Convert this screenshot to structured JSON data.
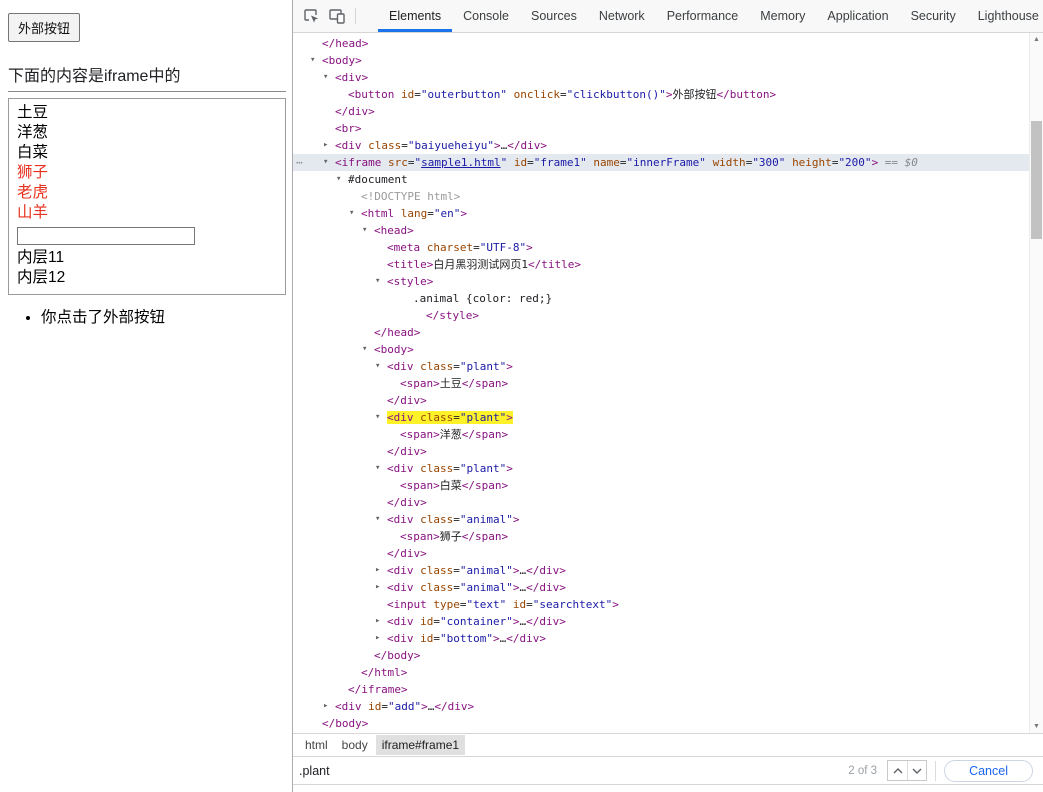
{
  "page": {
    "outer_button": "外部按钮",
    "heading": "下面的内容是iframe中的",
    "iframe": {
      "plants": [
        "土豆",
        "洋葱",
        "白菜"
      ],
      "animals": [
        "狮子",
        "老虎",
        "山羊"
      ],
      "input_value": "",
      "inner_items": [
        "内层11",
        "内层12"
      ]
    },
    "message": "你点击了外部按钮"
  },
  "devtools": {
    "tabs": [
      "Elements",
      "Console",
      "Sources",
      "Network",
      "Performance",
      "Memory",
      "Application",
      "Security",
      "Lighthouse"
    ],
    "active_tab": "Elements",
    "breadcrumbs": [
      "html",
      "body",
      "iframe#frame1"
    ],
    "selected_breadcrumb": "iframe#frame1",
    "find": {
      "query": ".plant",
      "matches": "2 of 3",
      "cancel_label": "Cancel"
    },
    "colors": {
      "accent": "#1a73e8",
      "tag": "#881280",
      "attribute": "#994500",
      "value": "#1a1aa6",
      "match_highlight": "#fdf129",
      "selected_row": "#e4e8ef",
      "animal_red": "#ff0000"
    },
    "tree": {
      "lines": [
        {
          "lvl": 1,
          "tk": [
            [
              "tag",
              "</head>"
            ]
          ]
        },
        {
          "lvl": 1,
          "arrow": "v",
          "tk": [
            [
              "tag",
              "<body>"
            ]
          ]
        },
        {
          "lvl": 2,
          "arrow": "v",
          "tk": [
            [
              "tag",
              "<div>"
            ]
          ]
        },
        {
          "lvl": 3,
          "tk": [
            [
              "tag",
              "<button"
            ],
            [
              "t",
              " "
            ],
            [
              "attr",
              "id"
            ],
            [
              "t",
              "="
            ],
            [
              "val",
              "\"outerbutton\""
            ],
            [
              "t",
              " "
            ],
            [
              "attr",
              "onclick"
            ],
            [
              "t",
              "="
            ],
            [
              "val",
              "\"clickbutton()\""
            ],
            [
              "tag",
              ">"
            ],
            [
              "t",
              "外部按钮"
            ],
            [
              "tag",
              "</button>"
            ]
          ]
        },
        {
          "lvl": 2,
          "tk": [
            [
              "tag",
              "</div>"
            ]
          ]
        },
        {
          "lvl": 2,
          "tk": [
            [
              "tag",
              "<br>"
            ]
          ]
        },
        {
          "lvl": 2,
          "arrow": "r",
          "tk": [
            [
              "tag",
              "<div"
            ],
            [
              "t",
              " "
            ],
            [
              "attr",
              "class"
            ],
            [
              "t",
              "="
            ],
            [
              "val",
              "\"baiyueheiyu\""
            ],
            [
              "tag",
              ">"
            ],
            [
              "t",
              "…"
            ],
            [
              "tag",
              "</div>"
            ]
          ]
        },
        {
          "lvl": 2,
          "arrow": "v",
          "sel": true,
          "dots": true,
          "tk": [
            [
              "tag",
              "<iframe"
            ],
            [
              "t",
              " "
            ],
            [
              "attr",
              "src"
            ],
            [
              "t",
              "="
            ],
            [
              "val",
              "\""
            ],
            [
              "link",
              "sample1.html"
            ],
            [
              "val",
              "\""
            ],
            [
              "t",
              " "
            ],
            [
              "attr",
              "id"
            ],
            [
              "t",
              "="
            ],
            [
              "val",
              "\"frame1\""
            ],
            [
              "t",
              " "
            ],
            [
              "attr",
              "name"
            ],
            [
              "t",
              "="
            ],
            [
              "val",
              "\"innerFrame\""
            ],
            [
              "t",
              " "
            ],
            [
              "attr",
              "width"
            ],
            [
              "t",
              "="
            ],
            [
              "val",
              "\"300\""
            ],
            [
              "t",
              " "
            ],
            [
              "attr",
              "height"
            ],
            [
              "t",
              "="
            ],
            [
              "val",
              "\"200\""
            ],
            [
              "tag",
              ">"
            ],
            [
              "dollar",
              " == $0"
            ]
          ]
        },
        {
          "lvl": 3,
          "arrow": "v",
          "tk": [
            [
              "t",
              "#document"
            ]
          ]
        },
        {
          "lvl": 4,
          "tk": [
            [
              "gray",
              "<!DOCTYPE html>"
            ]
          ]
        },
        {
          "lvl": 4,
          "arrow": "v",
          "tk": [
            [
              "tag",
              "<html"
            ],
            [
              "t",
              " "
            ],
            [
              "attr",
              "lang"
            ],
            [
              "t",
              "="
            ],
            [
              "val",
              "\"en\""
            ],
            [
              "tag",
              ">"
            ]
          ]
        },
        {
          "lvl": 5,
          "arrow": "v",
          "tk": [
            [
              "tag",
              "<head>"
            ]
          ]
        },
        {
          "lvl": 6,
          "tk": [
            [
              "tag",
              "<meta"
            ],
            [
              "t",
              " "
            ],
            [
              "attr",
              "charset"
            ],
            [
              "t",
              "="
            ],
            [
              "val",
              "\"UTF-8\""
            ],
            [
              "tag",
              ">"
            ]
          ]
        },
        {
          "lvl": 6,
          "tk": [
            [
              "tag",
              "<title>"
            ],
            [
              "t",
              "白月黑羽测试网页1"
            ],
            [
              "tag",
              "</title>"
            ]
          ]
        },
        {
          "lvl": 6,
          "arrow": "v",
          "tk": [
            [
              "tag",
              "<style>"
            ]
          ]
        },
        {
          "lvl": 8,
          "tk": [
            [
              "t",
              ".animal {color: red;}"
            ]
          ]
        },
        {
          "lvl": 9,
          "tk": [
            [
              "tag",
              "</style>"
            ]
          ]
        },
        {
          "lvl": 5,
          "tk": [
            [
              "tag",
              "</head>"
            ]
          ]
        },
        {
          "lvl": 5,
          "arrow": "v",
          "tk": [
            [
              "tag",
              "<body>"
            ]
          ]
        },
        {
          "lvl": 6,
          "arrow": "v",
          "tk": [
            [
              "tag",
              "<div"
            ],
            [
              "t",
              " "
            ],
            [
              "attr",
              "class"
            ],
            [
              "t",
              "="
            ],
            [
              "val",
              "\"plant\""
            ],
            [
              "tag",
              ">"
            ]
          ]
        },
        {
          "lvl": 7,
          "tk": [
            [
              "tag",
              "<span>"
            ],
            [
              "t",
              "土豆"
            ],
            [
              "tag",
              "</span>"
            ]
          ]
        },
        {
          "lvl": 6,
          "tk": [
            [
              "tag",
              "</div>"
            ]
          ]
        },
        {
          "lvl": 6,
          "arrow": "v",
          "hl": true,
          "tk": [
            [
              "tag",
              "<div"
            ],
            [
              "t",
              " "
            ],
            [
              "attr",
              "class"
            ],
            [
              "t",
              "="
            ],
            [
              "val",
              "\"plant\""
            ],
            [
              "tag",
              ">"
            ]
          ]
        },
        {
          "lvl": 7,
          "tk": [
            [
              "tag",
              "<span>"
            ],
            [
              "t",
              "洋葱"
            ],
            [
              "tag",
              "</span>"
            ]
          ]
        },
        {
          "lvl": 6,
          "tk": [
            [
              "tag",
              "</div>"
            ]
          ]
        },
        {
          "lvl": 6,
          "arrow": "v",
          "tk": [
            [
              "tag",
              "<div"
            ],
            [
              "t",
              " "
            ],
            [
              "attr",
              "class"
            ],
            [
              "t",
              "="
            ],
            [
              "val",
              "\"plant\""
            ],
            [
              "tag",
              ">"
            ]
          ]
        },
        {
          "lvl": 7,
          "tk": [
            [
              "tag",
              "<span>"
            ],
            [
              "t",
              "白菜"
            ],
            [
              "tag",
              "</span>"
            ]
          ]
        },
        {
          "lvl": 6,
          "tk": [
            [
              "tag",
              "</div>"
            ]
          ]
        },
        {
          "lvl": 6,
          "arrow": "v",
          "tk": [
            [
              "tag",
              "<div"
            ],
            [
              "t",
              " "
            ],
            [
              "attr",
              "class"
            ],
            [
              "t",
              "="
            ],
            [
              "val",
              "\"animal\""
            ],
            [
              "tag",
              ">"
            ]
          ]
        },
        {
          "lvl": 7,
          "tk": [
            [
              "tag",
              "<span>"
            ],
            [
              "t",
              "狮子"
            ],
            [
              "tag",
              "</span>"
            ]
          ]
        },
        {
          "lvl": 6,
          "tk": [
            [
              "tag",
              "</div>"
            ]
          ]
        },
        {
          "lvl": 6,
          "arrow": "r",
          "tk": [
            [
              "tag",
              "<div"
            ],
            [
              "t",
              " "
            ],
            [
              "attr",
              "class"
            ],
            [
              "t",
              "="
            ],
            [
              "val",
              "\"animal\""
            ],
            [
              "tag",
              ">"
            ],
            [
              "t",
              "…"
            ],
            [
              "tag",
              "</div>"
            ]
          ]
        },
        {
          "lvl": 6,
          "arrow": "r",
          "tk": [
            [
              "tag",
              "<div"
            ],
            [
              "t",
              " "
            ],
            [
              "attr",
              "class"
            ],
            [
              "t",
              "="
            ],
            [
              "val",
              "\"animal\""
            ],
            [
              "tag",
              ">"
            ],
            [
              "t",
              "…"
            ],
            [
              "tag",
              "</div>"
            ]
          ]
        },
        {
          "lvl": 6,
          "tk": [
            [
              "tag",
              "<input"
            ],
            [
              "t",
              " "
            ],
            [
              "attr",
              "type"
            ],
            [
              "t",
              "="
            ],
            [
              "val",
              "\"text\""
            ],
            [
              "t",
              " "
            ],
            [
              "attr",
              "id"
            ],
            [
              "t",
              "="
            ],
            [
              "val",
              "\"searchtext\""
            ],
            [
              "tag",
              ">"
            ]
          ]
        },
        {
          "lvl": 6,
          "arrow": "r",
          "tk": [
            [
              "tag",
              "<div"
            ],
            [
              "t",
              " "
            ],
            [
              "attr",
              "id"
            ],
            [
              "t",
              "="
            ],
            [
              "val",
              "\"container\""
            ],
            [
              "tag",
              ">"
            ],
            [
              "t",
              "…"
            ],
            [
              "tag",
              "</div>"
            ]
          ]
        },
        {
          "lvl": 6,
          "arrow": "r",
          "tk": [
            [
              "tag",
              "<div"
            ],
            [
              "t",
              " "
            ],
            [
              "attr",
              "id"
            ],
            [
              "t",
              "="
            ],
            [
              "val",
              "\"bottom\""
            ],
            [
              "tag",
              ">"
            ],
            [
              "t",
              "…"
            ],
            [
              "tag",
              "</div>"
            ]
          ]
        },
        {
          "lvl": 5,
          "tk": [
            [
              "tag",
              "</body>"
            ]
          ]
        },
        {
          "lvl": 4,
          "tk": [
            [
              "tag",
              "</html>"
            ]
          ]
        },
        {
          "lvl": 3,
          "tk": [
            [
              "tag",
              "</iframe>"
            ]
          ]
        },
        {
          "lvl": 2,
          "arrow": "r",
          "tk": [
            [
              "tag",
              "<div"
            ],
            [
              "t",
              " "
            ],
            [
              "attr",
              "id"
            ],
            [
              "t",
              "="
            ],
            [
              "val",
              "\"add\""
            ],
            [
              "tag",
              ">"
            ],
            [
              "t",
              "…"
            ],
            [
              "tag",
              "</div>"
            ]
          ]
        },
        {
          "lvl": 1,
          "tk": [
            [
              "tag",
              "</body>"
            ]
          ]
        }
      ]
    }
  }
}
